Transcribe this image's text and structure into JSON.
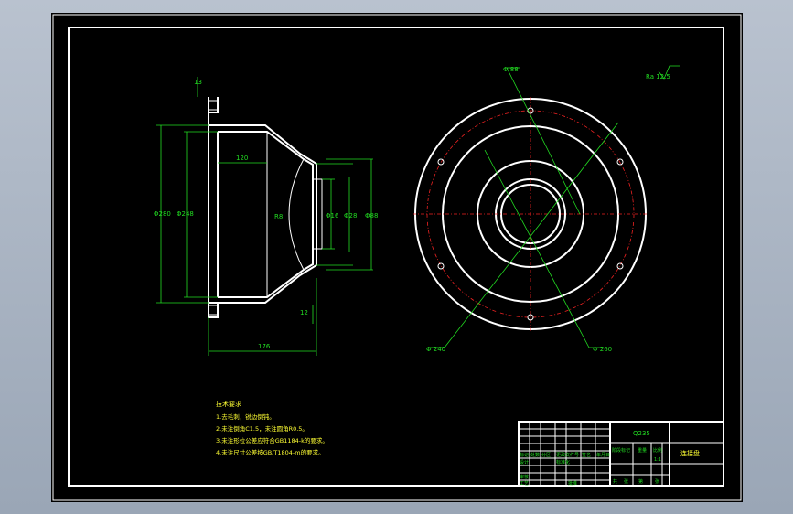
{
  "drawing": {
    "dims": {
      "top_label": "13",
      "width_inner": "120",
      "overall_length": "176",
      "left_dia_outer": "Φ280",
      "left_dia_inner": "Φ248",
      "chamfer_r": "R8",
      "dia_1": "Φ16",
      "dia_2": "Φ28",
      "dia_3": "Φ88",
      "small_dim": "12"
    },
    "circle_labels": {
      "top": "Φ 88",
      "bottom_left": "Φ 240",
      "bottom_right": "Φ 260"
    },
    "roughness": "Ra 12.5"
  },
  "notes": {
    "title": "技术要求",
    "items": [
      "1.去毛刺，锐边倒钝。",
      "2.未注倒角C1.5，未注圆角R0.5。",
      "3.未注形位公差应符合GB1184-k的要求。",
      "4.未注尺寸公差按GB/T1804-m的要求。"
    ]
  },
  "title_block": {
    "material": "Q235",
    "part_name": "连接盘",
    "row_labels": [
      "标记",
      "处数",
      "分区",
      "更改文件号",
      "签名",
      "年月日"
    ],
    "row2": [
      "设计",
      "标准化",
      "阶段标记",
      "重量",
      "比例"
    ],
    "row3": [
      "审核"
    ],
    "row4": [
      "工艺",
      "批准",
      "共",
      "张",
      "第",
      "张"
    ],
    "scale": "1:1"
  }
}
